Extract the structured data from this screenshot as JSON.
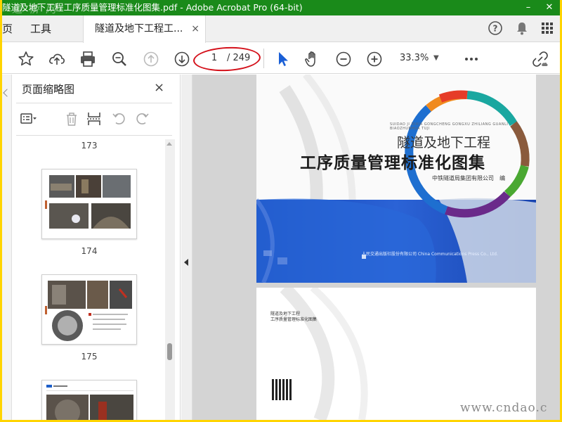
{
  "window": {
    "title": "隧道及地下工程工序质量管理标准化图集.pdf - Adobe Acrobat Pro (64-bit)",
    "watermark": "道 桥 网"
  },
  "tabs": {
    "home": "页",
    "tools": "工具",
    "document": "隧道及地下工程工...",
    "close_glyph": "×"
  },
  "toolbar": {
    "page_current": "1",
    "page_total": "/ 249",
    "zoom": "33.3%"
  },
  "thumbnails_panel": {
    "title": "页面缩略图",
    "close_glyph": "×",
    "pages": [
      "173",
      "174",
      "175"
    ]
  },
  "document": {
    "cover_subtitle": "隧道及地下工程",
    "cover_title": "工序质量管理标准化图集",
    "cover_publisher": "中铁隧道局集团有限公司　编",
    "cover_pinyin": "SUIDAO JI DIXIA GONGCHENG GONGXU ZHILIANG GUANLI BIAOZHUNHUA TUJI",
    "cover_press": "人民交通出版社股份有限公司 China Communications Press Co., Ltd.",
    "page2_line1": "隧道及地下工程",
    "page2_line2": "工序质量管理标准化图集",
    "ring_colors": [
      "#e63c28",
      "#1aa7a0",
      "#8a5a3c",
      "#4aa832",
      "#6a2a8a",
      "#1e6fd0",
      "#f08a1e"
    ]
  },
  "footer_watermark": "www.cndao.c"
}
